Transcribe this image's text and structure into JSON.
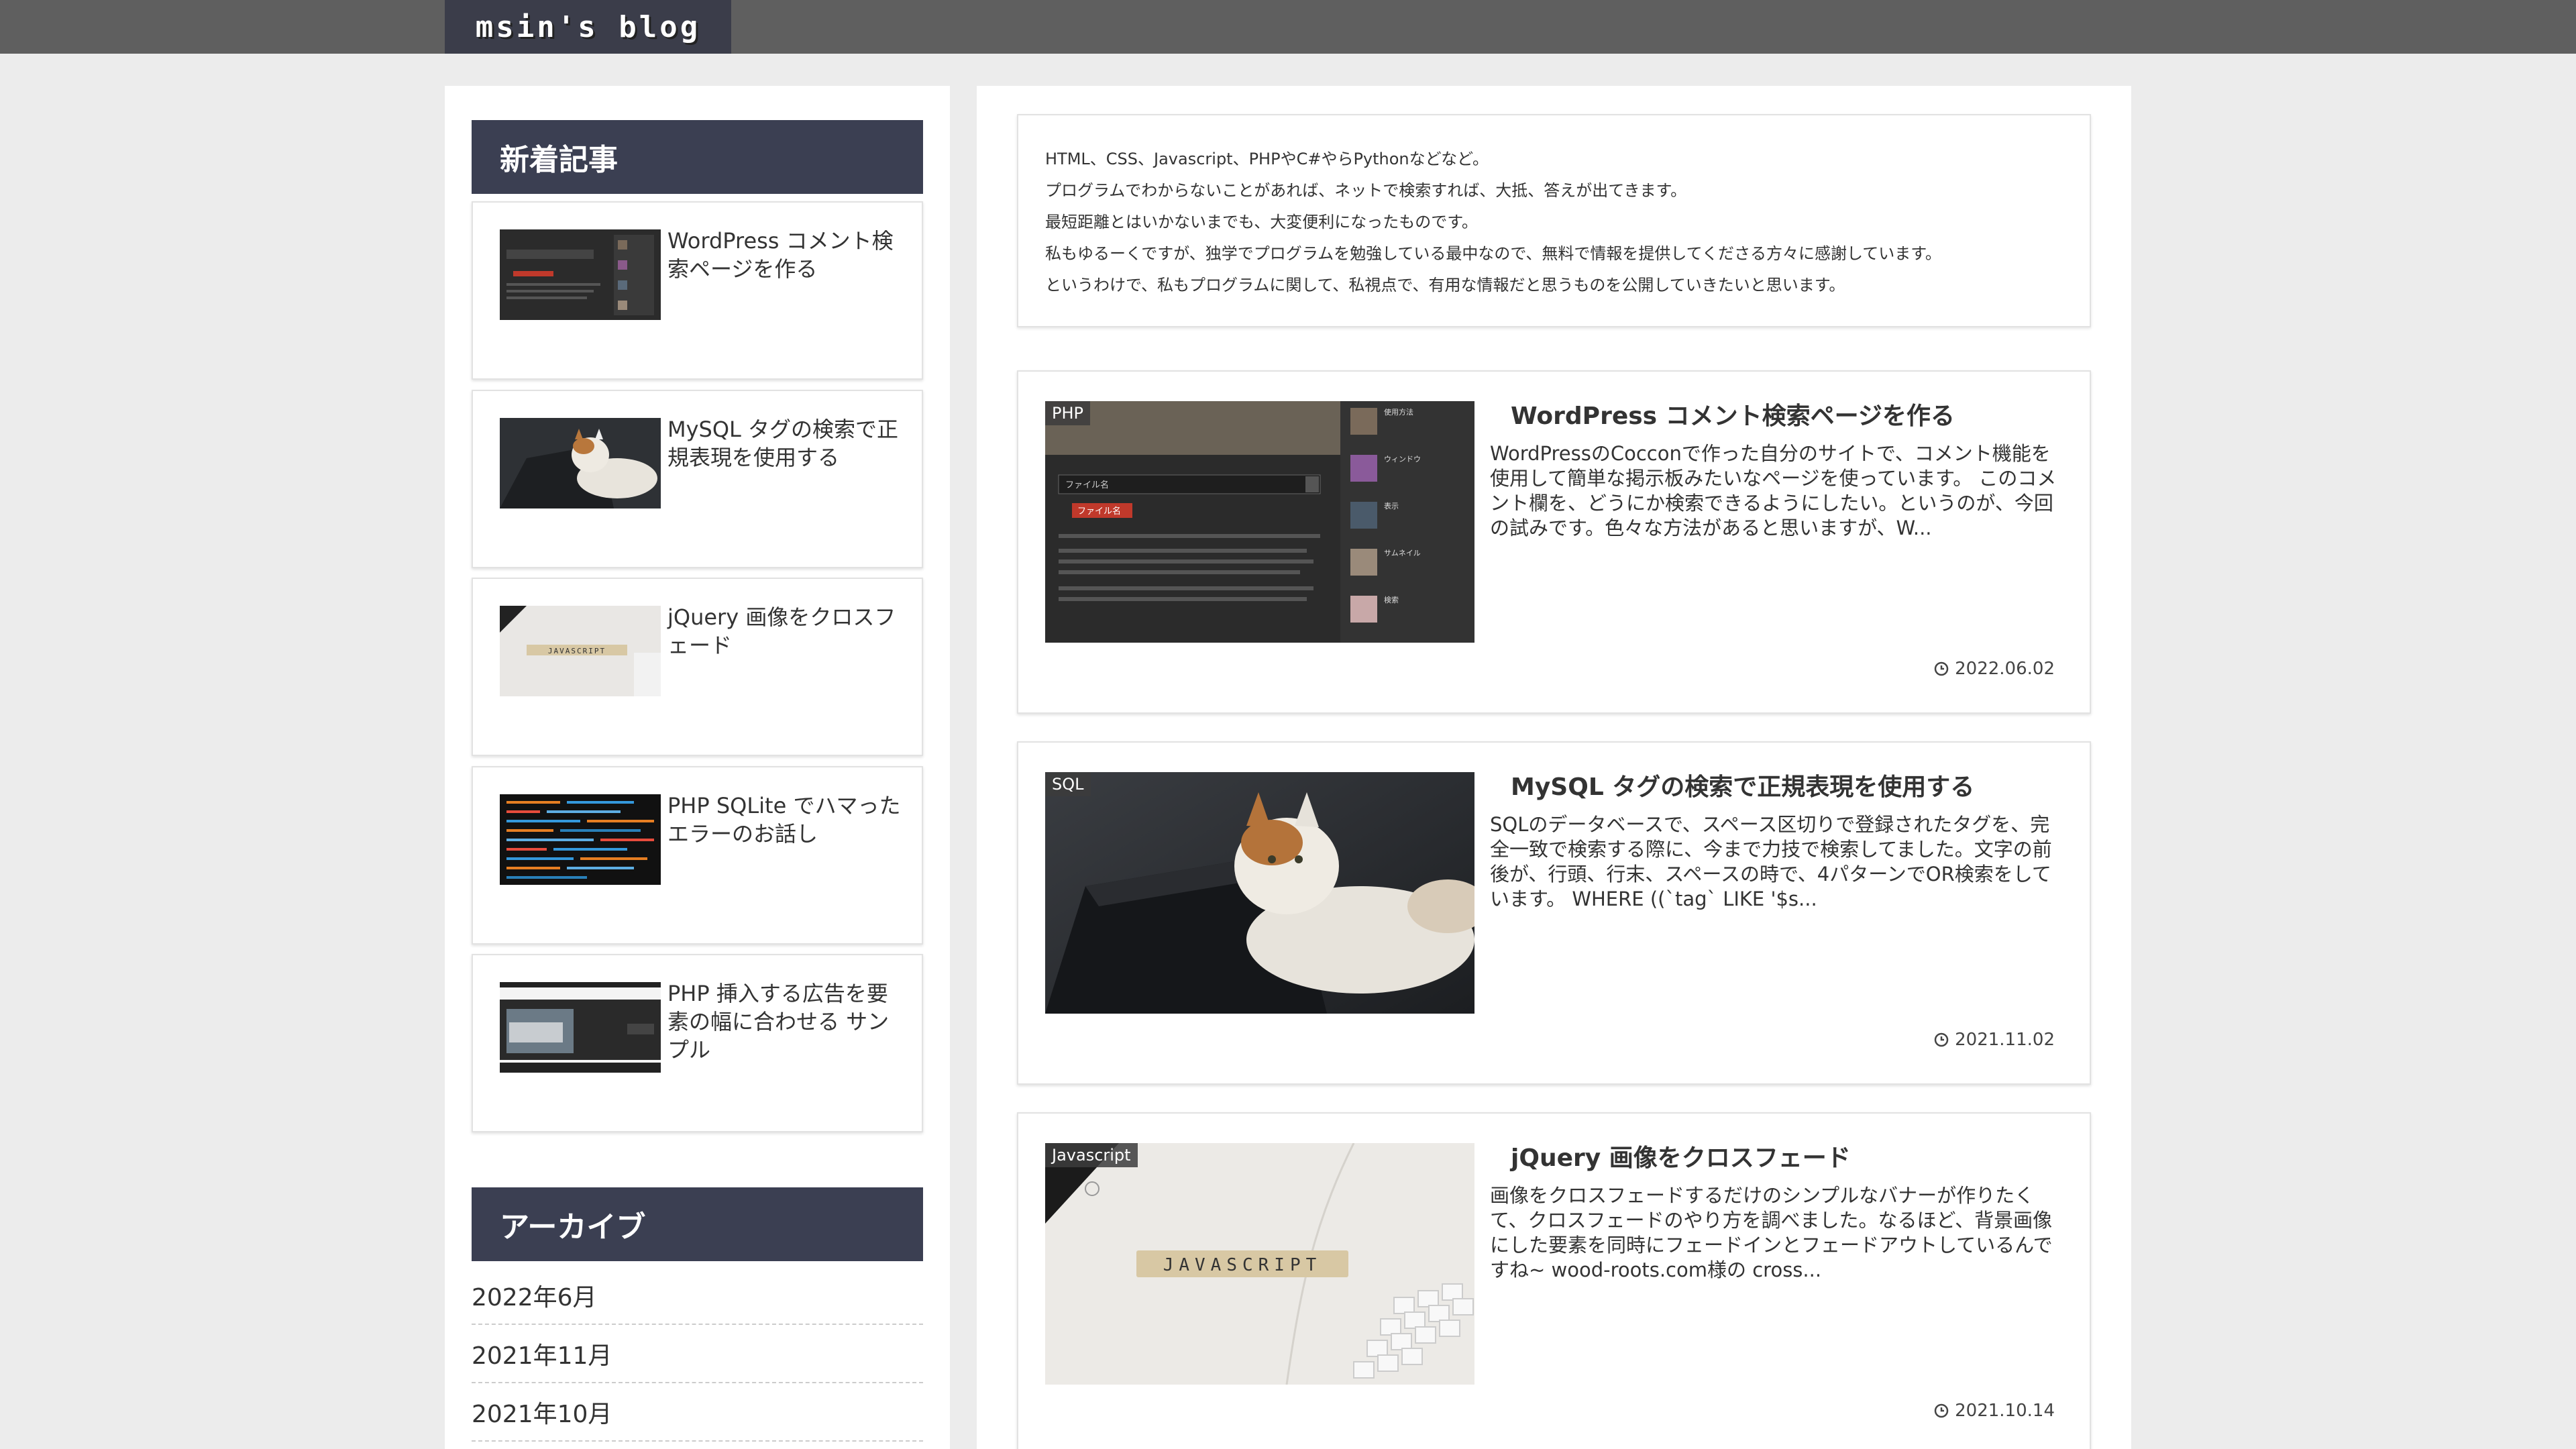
{
  "site": {
    "logo_text": "msin's blog"
  },
  "sidebar": {
    "new_title": "新着記事",
    "new_items": [
      {
        "title": "WordPress コメント検索ページを作る",
        "thumb": "wordpress-screenshot"
      },
      {
        "title": "MySQL タグの検索で正規表現を使用する",
        "thumb": "cat-laptop"
      },
      {
        "title": "jQuery 画像をクロスフェード",
        "thumb": "javascript-tiles"
      },
      {
        "title": "PHP SQLite でハマった エラーのお話し",
        "thumb": "code-screen"
      },
      {
        "title": "PHP 挿入する広告を要素の幅に合わせる サンプル",
        "thumb": "ad-sample"
      }
    ],
    "archive_title": "アーカイブ",
    "archive_items": [
      "2022年6月",
      "2021年11月",
      "2021年10月"
    ]
  },
  "intro": {
    "lines": [
      "HTML、CSS、Javascript、PHPやC#やらPythonなどなど。",
      "プログラムでわからないことがあれば、ネットで検索すれば、大抵、答えが出てきます。",
      "最短距離とはいかないまでも、大変便利になったものです。",
      "私もゆるーくですが、独学でプログラムを勉強している最中なので、無料で情報を提供してくださる方々に感謝しています。",
      "というわけで、私もプログラムに関して、私視点で、有用な情報だと思うものを公開していきたいと思います。"
    ]
  },
  "entries": [
    {
      "category": "PHP",
      "title": "WordPress コメント検索ページを作る",
      "snippet": "WordPressのCocconで作った自分のサイトで、コメント機能を使用して簡単な掲示板みたいなページを使っています。 このコメント欄を、どうにか検索できるようにしたい。というのが、今回の試みです。色々な方法があると思いますが、W...",
      "date": "2022.06.02",
      "thumb": {
        "search_text": "ファイル名",
        "highlight_text": "ファイル名",
        "side_labels": [
          "使用方法",
          "ウィンドウ",
          "表示",
          "サムネイル",
          "検索"
        ]
      }
    },
    {
      "category": "SQL",
      "title": "MySQL タグの検索で正規表現を使用する",
      "snippet": "SQLのデータベースで、スペース区切りで登録されたタグを、完全一致で検索する際に、今まで力技で検索してました。文字の前後が、行頭、行末、スペースの時で、4パターンでOR検索をしています。 WHERE ((`tag` LIKE '$s...",
      "date": "2021.11.02"
    },
    {
      "category": "Javascript",
      "title": "jQuery 画像をクロスフェード",
      "snippet": "画像をクロスフェードするだけのシンプルなバナーが作りたくて、クロスフェードのやり方を調べました。なるほど、背景画像にした要素を同時にフェードインとフェードアウトしているんですね~ wood-roots.com様の cross...",
      "date": "2021.10.14",
      "thumb": {
        "tiles_text": "JAVASCRIPT"
      }
    }
  ]
}
